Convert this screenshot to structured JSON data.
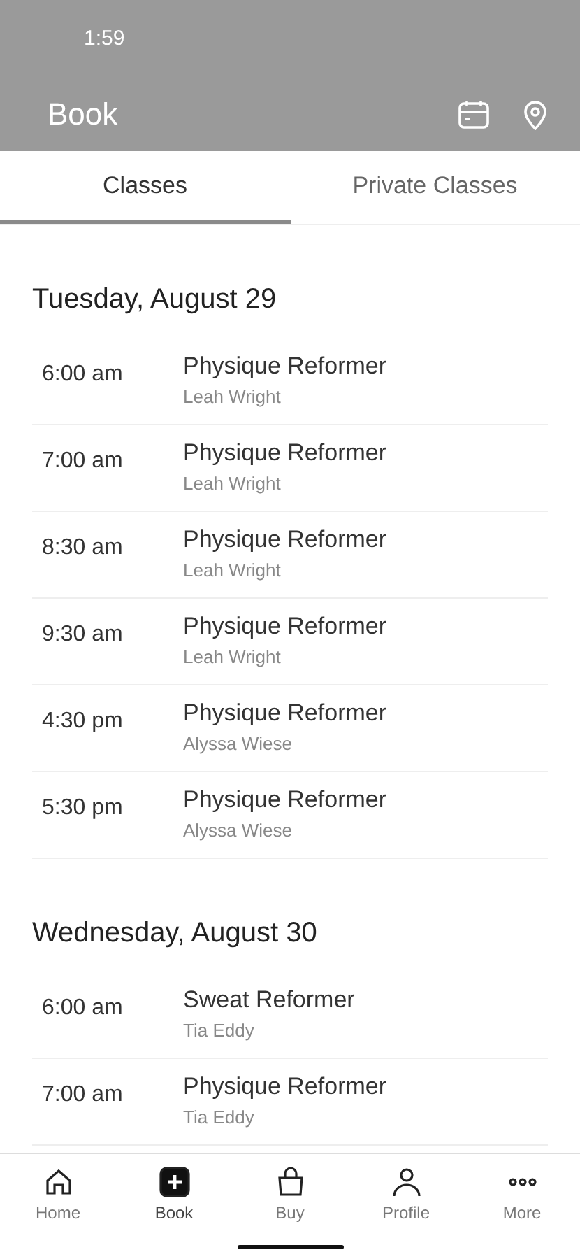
{
  "status_bar": {
    "time": "1:59"
  },
  "app_bar": {
    "title": "Book"
  },
  "tabs": [
    {
      "label": "Classes",
      "selected": true
    },
    {
      "label": "Private Classes",
      "selected": false
    }
  ],
  "days": [
    {
      "heading": "Tuesday, August 29",
      "classes": [
        {
          "time": "6:00 am",
          "name": "Physique Reformer",
          "instructor": "Leah Wright"
        },
        {
          "time": "7:00 am",
          "name": "Physique Reformer",
          "instructor": "Leah Wright"
        },
        {
          "time": "8:30 am",
          "name": "Physique Reformer",
          "instructor": "Leah Wright"
        },
        {
          "time": "9:30 am",
          "name": "Physique Reformer",
          "instructor": "Leah Wright"
        },
        {
          "time": "4:30 pm",
          "name": "Physique Reformer",
          "instructor": "Alyssa Wiese"
        },
        {
          "time": "5:30 pm",
          "name": "Physique Reformer",
          "instructor": "Alyssa Wiese"
        }
      ]
    },
    {
      "heading": "Wednesday, August 30",
      "classes": [
        {
          "time": "6:00 am",
          "name": "Sweat Reformer",
          "instructor": "Tia Eddy"
        },
        {
          "time": "7:00 am",
          "name": "Physique Reformer",
          "instructor": "Tia Eddy"
        }
      ]
    }
  ],
  "nav": [
    {
      "label": "Home",
      "kind": "home",
      "selected": false
    },
    {
      "label": "Book",
      "kind": "book",
      "selected": true
    },
    {
      "label": "Buy",
      "kind": "buy",
      "selected": false
    },
    {
      "label": "Profile",
      "kind": "profile",
      "selected": false
    },
    {
      "label": "More",
      "kind": "more",
      "selected": false
    }
  ]
}
